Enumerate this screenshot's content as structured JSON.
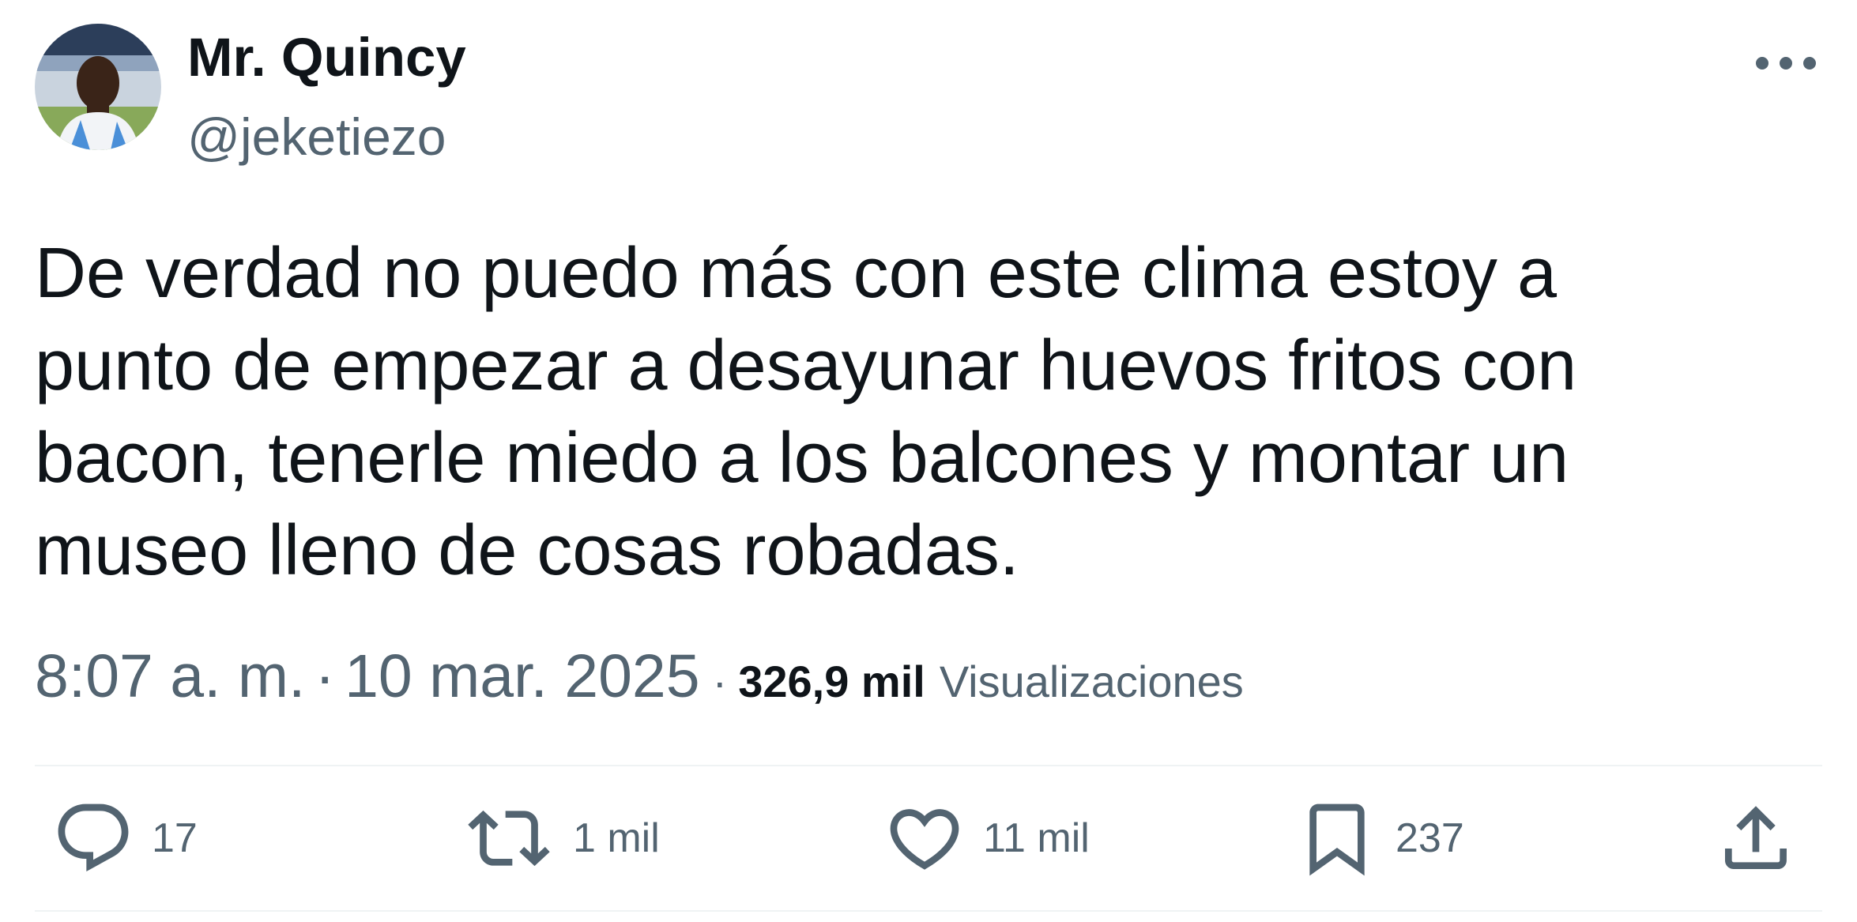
{
  "author": {
    "display_name": "Mr. Quincy",
    "handle": "@jeketiezo",
    "avatar_icon": "profile-photo"
  },
  "tweet": {
    "text_lines": [
      "De verdad no puedo más con este clima estoy a",
      "punto de empezar a desayunar huevos fritos con",
      "bacon, tenerle miedo a los balcones y montar un",
      "museo lleno de cosas robadas."
    ],
    "time": "8:07 a. m.",
    "date": "10 mar. 2025",
    "views_count": "326,9 mil",
    "views_label": "Visualizaciones"
  },
  "actions": {
    "reply": {
      "icon": "reply-icon",
      "count": "17"
    },
    "retweet": {
      "icon": "retweet-icon",
      "count": "1 mil"
    },
    "like": {
      "icon": "heart-icon",
      "count": "11 mil"
    },
    "bookmark": {
      "icon": "bookmark-icon",
      "count": "237"
    },
    "share": {
      "icon": "share-icon"
    }
  },
  "more_menu": {
    "icon": "more-icon"
  },
  "colors": {
    "text_primary": "#0f1419",
    "text_secondary": "#536471",
    "divider": "#eff3f4"
  }
}
